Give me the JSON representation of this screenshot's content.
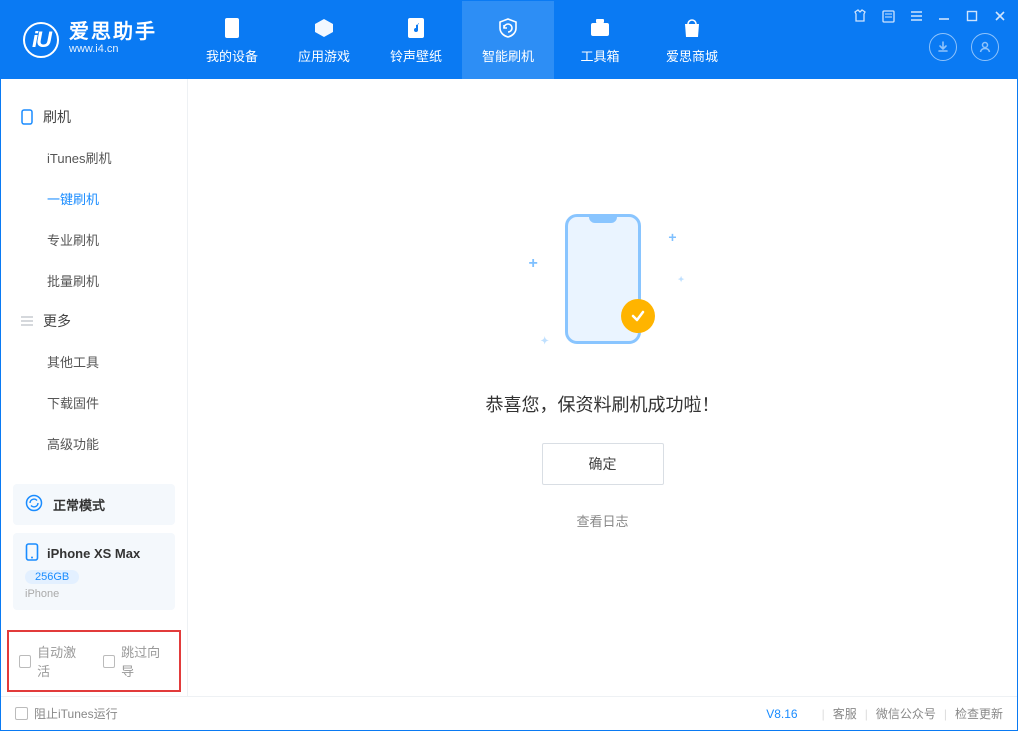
{
  "logo": {
    "glyph": "iU",
    "line1": "爱思助手",
    "line2": "www.i4.cn"
  },
  "tabs": [
    {
      "label": "我的设备"
    },
    {
      "label": "应用游戏"
    },
    {
      "label": "铃声壁纸"
    },
    {
      "label": "智能刷机"
    },
    {
      "label": "工具箱"
    },
    {
      "label": "爱思商城"
    }
  ],
  "sidebar": {
    "group1": {
      "title": "刷机",
      "items": [
        "iTunes刷机",
        "一键刷机",
        "专业刷机",
        "批量刷机"
      ]
    },
    "group2": {
      "title": "更多",
      "items": [
        "其他工具",
        "下载固件",
        "高级功能"
      ]
    },
    "mode_card": {
      "label": "正常模式"
    },
    "device_card": {
      "name": "iPhone XS Max",
      "storage": "256GB",
      "type": "iPhone"
    },
    "checks": {
      "auto_activate": "自动激活",
      "skip_guide": "跳过向导"
    }
  },
  "main": {
    "message": "恭喜您，保资料刷机成功啦！",
    "confirm": "确定",
    "log_link": "查看日志"
  },
  "footer": {
    "block_itunes": "阻止iTunes运行",
    "version": "V8.16",
    "links": [
      "客服",
      "微信公众号",
      "检查更新"
    ]
  }
}
